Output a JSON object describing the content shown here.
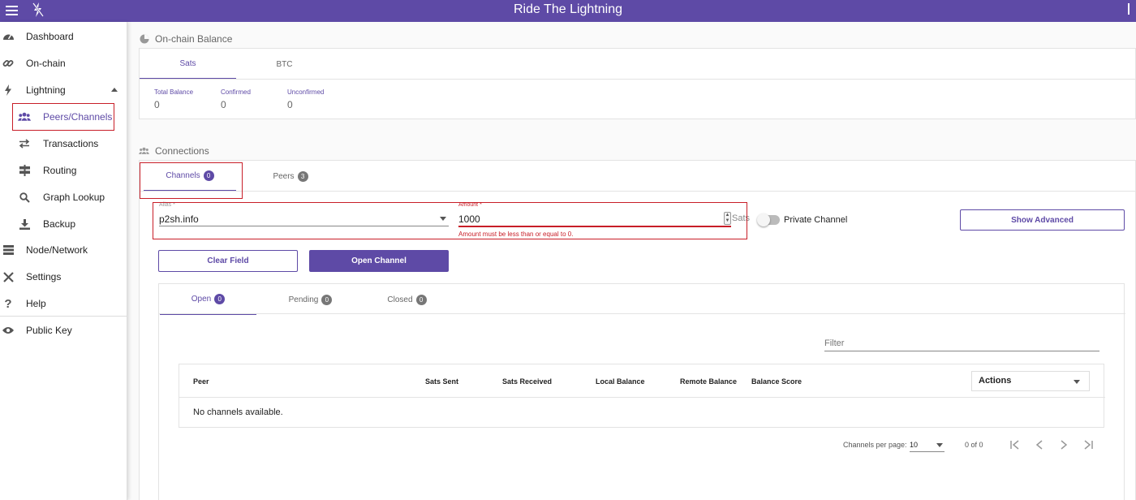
{
  "app": {
    "title": "Ride The Lightning"
  },
  "sidebar": {
    "items": [
      {
        "label": "Dashboard",
        "icon": "gauge-icon"
      },
      {
        "label": "On-chain",
        "icon": "link-icon"
      },
      {
        "label": "Lightning",
        "icon": "bolt-icon"
      },
      {
        "label": "Peers/Channels",
        "icon": "users-icon"
      },
      {
        "label": "Transactions",
        "icon": "exchange-icon"
      },
      {
        "label": "Routing",
        "icon": "signpost-icon"
      },
      {
        "label": "Graph Lookup",
        "icon": "search-icon"
      },
      {
        "label": "Backup",
        "icon": "download-icon"
      },
      {
        "label": "Node/Network",
        "icon": "server-icon"
      },
      {
        "label": "Settings",
        "icon": "tools-icon"
      },
      {
        "label": "Help",
        "icon": "question-icon"
      },
      {
        "label": "Public Key",
        "icon": "eye-icon"
      }
    ]
  },
  "onchain": {
    "heading": "On-chain Balance",
    "tabs": [
      "Sats",
      "BTC"
    ],
    "balances": [
      {
        "label": "Total Balance",
        "value": "0"
      },
      {
        "label": "Confirmed",
        "value": "0"
      },
      {
        "label": "Unconfirmed",
        "value": "0"
      }
    ]
  },
  "connections": {
    "heading": "Connections",
    "tabs": [
      {
        "label": "Channels",
        "count": "0"
      },
      {
        "label": "Peers",
        "count": "3"
      }
    ]
  },
  "form": {
    "alias_label": "Alias *",
    "alias_value": "p2sh.info",
    "amount_label": "Amount *",
    "amount_value": "1000",
    "amount_suffix": "Sats",
    "amount_error": "Amount must be less than or equal to 0.",
    "private_label": "Private Channel",
    "show_advanced": "Show Advanced",
    "clear_field": "Clear Field",
    "open_channel": "Open Channel"
  },
  "channels": {
    "tabs": [
      {
        "label": "Open",
        "count": "0"
      },
      {
        "label": "Pending",
        "count": "0"
      },
      {
        "label": "Closed",
        "count": "0"
      }
    ],
    "filter_placeholder": "Filter",
    "columns": [
      "Peer",
      "Sats Sent",
      "Sats Received",
      "Local Balance",
      "Remote Balance",
      "Balance Score"
    ],
    "actions_label": "Actions",
    "empty_text": "No channels available.",
    "pager": {
      "per_page_label": "Channels per page:",
      "per_page_value": "10",
      "range": "0 of 0"
    }
  },
  "colors": {
    "accent": "#5e4aa6",
    "error": "#c81e28"
  }
}
